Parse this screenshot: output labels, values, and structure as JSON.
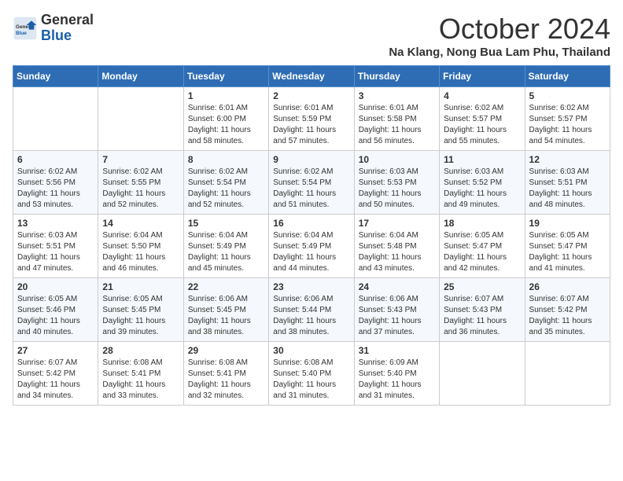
{
  "header": {
    "logo_general": "General",
    "logo_blue": "Blue",
    "title": "October 2024",
    "subtitle": "Na Klang, Nong Bua Lam Phu, Thailand"
  },
  "weekdays": [
    "Sunday",
    "Monday",
    "Tuesday",
    "Wednesday",
    "Thursday",
    "Friday",
    "Saturday"
  ],
  "weeks": [
    [
      {
        "day": "",
        "sunrise": "",
        "sunset": "",
        "daylight": ""
      },
      {
        "day": "",
        "sunrise": "",
        "sunset": "",
        "daylight": ""
      },
      {
        "day": "1",
        "sunrise": "Sunrise: 6:01 AM",
        "sunset": "Sunset: 6:00 PM",
        "daylight": "Daylight: 11 hours and 58 minutes."
      },
      {
        "day": "2",
        "sunrise": "Sunrise: 6:01 AM",
        "sunset": "Sunset: 5:59 PM",
        "daylight": "Daylight: 11 hours and 57 minutes."
      },
      {
        "day": "3",
        "sunrise": "Sunrise: 6:01 AM",
        "sunset": "Sunset: 5:58 PM",
        "daylight": "Daylight: 11 hours and 56 minutes."
      },
      {
        "day": "4",
        "sunrise": "Sunrise: 6:02 AM",
        "sunset": "Sunset: 5:57 PM",
        "daylight": "Daylight: 11 hours and 55 minutes."
      },
      {
        "day": "5",
        "sunrise": "Sunrise: 6:02 AM",
        "sunset": "Sunset: 5:57 PM",
        "daylight": "Daylight: 11 hours and 54 minutes."
      }
    ],
    [
      {
        "day": "6",
        "sunrise": "Sunrise: 6:02 AM",
        "sunset": "Sunset: 5:56 PM",
        "daylight": "Daylight: 11 hours and 53 minutes."
      },
      {
        "day": "7",
        "sunrise": "Sunrise: 6:02 AM",
        "sunset": "Sunset: 5:55 PM",
        "daylight": "Daylight: 11 hours and 52 minutes."
      },
      {
        "day": "8",
        "sunrise": "Sunrise: 6:02 AM",
        "sunset": "Sunset: 5:54 PM",
        "daylight": "Daylight: 11 hours and 52 minutes."
      },
      {
        "day": "9",
        "sunrise": "Sunrise: 6:02 AM",
        "sunset": "Sunset: 5:54 PM",
        "daylight": "Daylight: 11 hours and 51 minutes."
      },
      {
        "day": "10",
        "sunrise": "Sunrise: 6:03 AM",
        "sunset": "Sunset: 5:53 PM",
        "daylight": "Daylight: 11 hours and 50 minutes."
      },
      {
        "day": "11",
        "sunrise": "Sunrise: 6:03 AM",
        "sunset": "Sunset: 5:52 PM",
        "daylight": "Daylight: 11 hours and 49 minutes."
      },
      {
        "day": "12",
        "sunrise": "Sunrise: 6:03 AM",
        "sunset": "Sunset: 5:51 PM",
        "daylight": "Daylight: 11 hours and 48 minutes."
      }
    ],
    [
      {
        "day": "13",
        "sunrise": "Sunrise: 6:03 AM",
        "sunset": "Sunset: 5:51 PM",
        "daylight": "Daylight: 11 hours and 47 minutes."
      },
      {
        "day": "14",
        "sunrise": "Sunrise: 6:04 AM",
        "sunset": "Sunset: 5:50 PM",
        "daylight": "Daylight: 11 hours and 46 minutes."
      },
      {
        "day": "15",
        "sunrise": "Sunrise: 6:04 AM",
        "sunset": "Sunset: 5:49 PM",
        "daylight": "Daylight: 11 hours and 45 minutes."
      },
      {
        "day": "16",
        "sunrise": "Sunrise: 6:04 AM",
        "sunset": "Sunset: 5:49 PM",
        "daylight": "Daylight: 11 hours and 44 minutes."
      },
      {
        "day": "17",
        "sunrise": "Sunrise: 6:04 AM",
        "sunset": "Sunset: 5:48 PM",
        "daylight": "Daylight: 11 hours and 43 minutes."
      },
      {
        "day": "18",
        "sunrise": "Sunrise: 6:05 AM",
        "sunset": "Sunset: 5:47 PM",
        "daylight": "Daylight: 11 hours and 42 minutes."
      },
      {
        "day": "19",
        "sunrise": "Sunrise: 6:05 AM",
        "sunset": "Sunset: 5:47 PM",
        "daylight": "Daylight: 11 hours and 41 minutes."
      }
    ],
    [
      {
        "day": "20",
        "sunrise": "Sunrise: 6:05 AM",
        "sunset": "Sunset: 5:46 PM",
        "daylight": "Daylight: 11 hours and 40 minutes."
      },
      {
        "day": "21",
        "sunrise": "Sunrise: 6:05 AM",
        "sunset": "Sunset: 5:45 PM",
        "daylight": "Daylight: 11 hours and 39 minutes."
      },
      {
        "day": "22",
        "sunrise": "Sunrise: 6:06 AM",
        "sunset": "Sunset: 5:45 PM",
        "daylight": "Daylight: 11 hours and 38 minutes."
      },
      {
        "day": "23",
        "sunrise": "Sunrise: 6:06 AM",
        "sunset": "Sunset: 5:44 PM",
        "daylight": "Daylight: 11 hours and 38 minutes."
      },
      {
        "day": "24",
        "sunrise": "Sunrise: 6:06 AM",
        "sunset": "Sunset: 5:43 PM",
        "daylight": "Daylight: 11 hours and 37 minutes."
      },
      {
        "day": "25",
        "sunrise": "Sunrise: 6:07 AM",
        "sunset": "Sunset: 5:43 PM",
        "daylight": "Daylight: 11 hours and 36 minutes."
      },
      {
        "day": "26",
        "sunrise": "Sunrise: 6:07 AM",
        "sunset": "Sunset: 5:42 PM",
        "daylight": "Daylight: 11 hours and 35 minutes."
      }
    ],
    [
      {
        "day": "27",
        "sunrise": "Sunrise: 6:07 AM",
        "sunset": "Sunset: 5:42 PM",
        "daylight": "Daylight: 11 hours and 34 minutes."
      },
      {
        "day": "28",
        "sunrise": "Sunrise: 6:08 AM",
        "sunset": "Sunset: 5:41 PM",
        "daylight": "Daylight: 11 hours and 33 minutes."
      },
      {
        "day": "29",
        "sunrise": "Sunrise: 6:08 AM",
        "sunset": "Sunset: 5:41 PM",
        "daylight": "Daylight: 11 hours and 32 minutes."
      },
      {
        "day": "30",
        "sunrise": "Sunrise: 6:08 AM",
        "sunset": "Sunset: 5:40 PM",
        "daylight": "Daylight: 11 hours and 31 minutes."
      },
      {
        "day": "31",
        "sunrise": "Sunrise: 6:09 AM",
        "sunset": "Sunset: 5:40 PM",
        "daylight": "Daylight: 11 hours and 31 minutes."
      },
      {
        "day": "",
        "sunrise": "",
        "sunset": "",
        "daylight": ""
      },
      {
        "day": "",
        "sunrise": "",
        "sunset": "",
        "daylight": ""
      }
    ]
  ]
}
